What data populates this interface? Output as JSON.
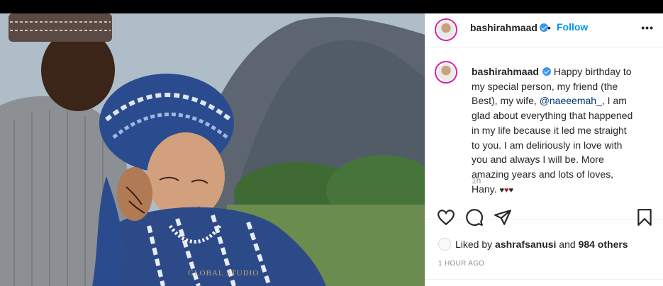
{
  "post": {
    "username": "bashirahmaad",
    "separator": "•",
    "follow_label": "Follow",
    "more_label": "•••",
    "caption_parts": {
      "before_mention": "Happy birthday to my special person, my friend (the Best), my wife, ",
      "mention": "@naeeemah_",
      "after_mention": ", I am glad about everything that happened in my life because it led me straight to you. I am deliriously in love with you and always I will be. More amazing years and lots of loves, Hany. "
    },
    "caption_time": "1h",
    "likes": {
      "prefix": "Liked by ",
      "liker": "ashrafsanusi",
      "middle": " and ",
      "others": "984 others"
    },
    "posted_ago": "1 HOUR AGO"
  },
  "photo": {
    "watermark": "GLOBAL STUDIO"
  },
  "colors": {
    "accent": "#0095f6",
    "verified": "#3897f0",
    "muted": "#8e8e8e"
  }
}
